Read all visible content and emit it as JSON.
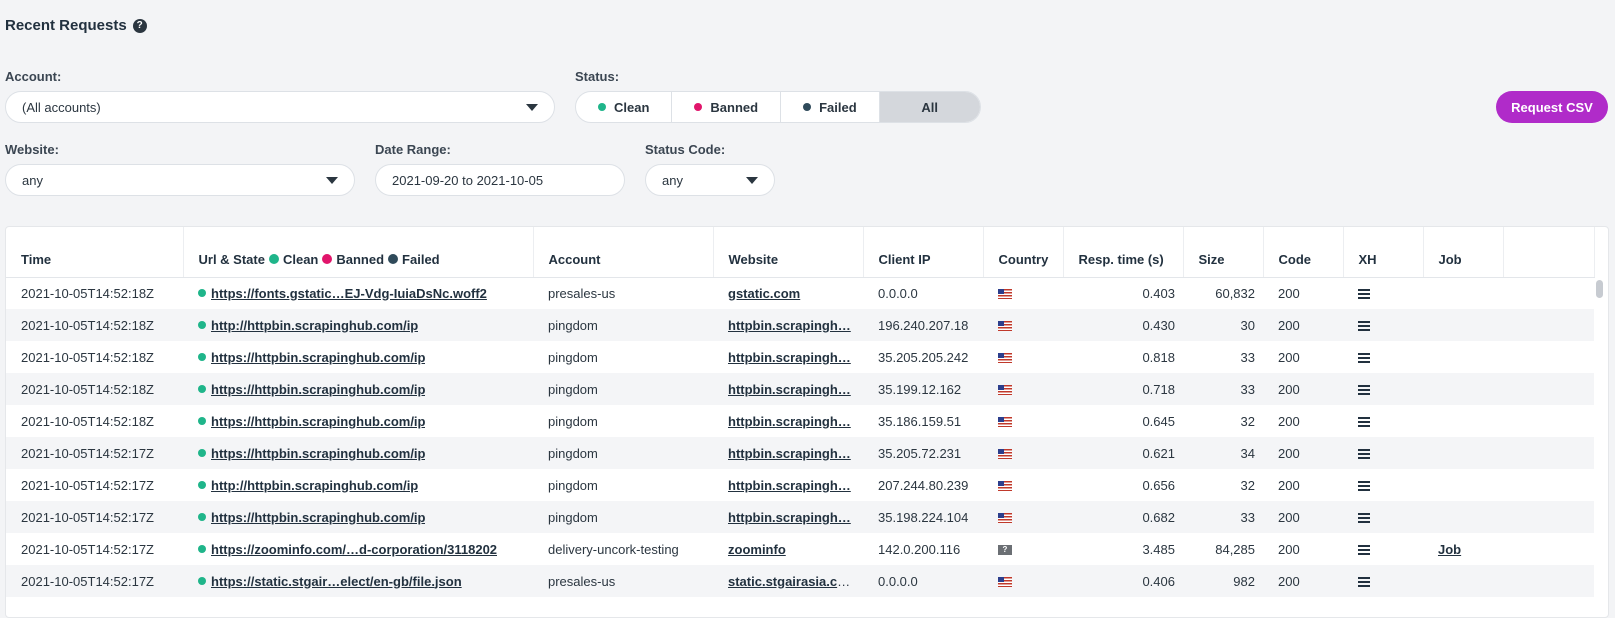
{
  "header": {
    "title": "Recent Requests",
    "help_icon": "?"
  },
  "filters": {
    "account_label": "Account:",
    "account_value": "(All accounts)",
    "status_label": "Status:",
    "status_options": [
      {
        "label": "Clean",
        "color": "#1fb58a"
      },
      {
        "label": "Banned",
        "color": "#e1156b"
      },
      {
        "label": "Failed",
        "color": "#2f4a5a"
      },
      {
        "label": "All",
        "selected": true
      }
    ],
    "website_label": "Website:",
    "website_value": "any",
    "date_label": "Date Range:",
    "date_value": "2021-09-20 to 2021-10-05",
    "code_label": "Status Code:",
    "code_value": "any",
    "csv_button": "Request CSV"
  },
  "colors": {
    "accent": "#b02bc9",
    "clean": "#1fb58a",
    "banned": "#e1156b",
    "failed": "#2f4a5a"
  },
  "table": {
    "columns": {
      "time": "Time",
      "url": "Url & State",
      "legend_clean": "Clean",
      "legend_banned": "Banned",
      "legend_failed": "Failed",
      "account": "Account",
      "website": "Website",
      "client_ip": "Client IP",
      "country": "Country",
      "resp_time": "Resp. time (s)",
      "size": "Size",
      "code": "Code",
      "xh": "XH",
      "job": "Job"
    },
    "rows": [
      {
        "time": "2021-10-05T14:52:18Z",
        "url": "https://fonts.gstatic…EJ-Vdg-IuiaDsNc.woff2",
        "account": "presales-us",
        "website": "gstatic.com",
        "ip": "0.0.0.0",
        "country": "us-flag-icon",
        "resp": "0.403",
        "size": "60,832",
        "code": "200",
        "job": ""
      },
      {
        "time": "2021-10-05T14:52:18Z",
        "url": "http://httpbin.scrapinghub.com/ip",
        "account": "pingdom",
        "website": "httpbin.scrapingh…",
        "ip": "196.240.207.18",
        "country": "us-flag-icon",
        "resp": "0.430",
        "size": "30",
        "code": "200",
        "job": ""
      },
      {
        "time": "2021-10-05T14:52:18Z",
        "url": "https://httpbin.scrapinghub.com/ip",
        "account": "pingdom",
        "website": "httpbin.scrapingh…",
        "ip": "35.205.205.242",
        "country": "us-flag-icon",
        "resp": "0.818",
        "size": "33",
        "code": "200",
        "job": ""
      },
      {
        "time": "2021-10-05T14:52:18Z",
        "url": "https://httpbin.scrapinghub.com/ip",
        "account": "pingdom",
        "website": "httpbin.scrapingh…",
        "ip": "35.199.12.162",
        "country": "us-flag-icon",
        "resp": "0.718",
        "size": "33",
        "code": "200",
        "job": ""
      },
      {
        "time": "2021-10-05T14:52:18Z",
        "url": "https://httpbin.scrapinghub.com/ip",
        "account": "pingdom",
        "website": "httpbin.scrapingh…",
        "ip": "35.186.159.51",
        "country": "us-flag-icon",
        "resp": "0.645",
        "size": "32",
        "code": "200",
        "job": ""
      },
      {
        "time": "2021-10-05T14:52:17Z",
        "url": "https://httpbin.scrapinghub.com/ip",
        "account": "pingdom",
        "website": "httpbin.scrapingh…",
        "ip": "35.205.72.231",
        "country": "us-flag-icon",
        "resp": "0.621",
        "size": "34",
        "code": "200",
        "job": ""
      },
      {
        "time": "2021-10-05T14:52:17Z",
        "url": "http://httpbin.scrapinghub.com/ip",
        "account": "pingdom",
        "website": "httpbin.scrapingh…",
        "ip": "207.244.80.239",
        "country": "us-flag-icon",
        "resp": "0.656",
        "size": "32",
        "code": "200",
        "job": ""
      },
      {
        "time": "2021-10-05T14:52:17Z",
        "url": "https://httpbin.scrapinghub.com/ip",
        "account": "pingdom",
        "website": "httpbin.scrapingh…",
        "ip": "35.198.224.104",
        "country": "us-flag-icon",
        "resp": "0.682",
        "size": "33",
        "code": "200",
        "job": ""
      },
      {
        "time": "2021-10-05T14:52:17Z",
        "url": "https://zoominfo.com/…d-corporation/3118202",
        "account": "delivery-uncork-testing",
        "website": "zoominfo",
        "ip": "142.0.200.116",
        "country": "unknown-flag-icon",
        "resp": "3.485",
        "size": "84,285",
        "code": "200",
        "job": "Job"
      },
      {
        "time": "2021-10-05T14:52:17Z",
        "url": "https://static.stgair…elect/en-gb/file.json",
        "account": "presales-us",
        "website": "static.stgairasia.co…",
        "ip": "0.0.0.0",
        "country": "us-flag-icon",
        "resp": "0.406",
        "size": "982",
        "code": "200",
        "job": ""
      }
    ]
  }
}
